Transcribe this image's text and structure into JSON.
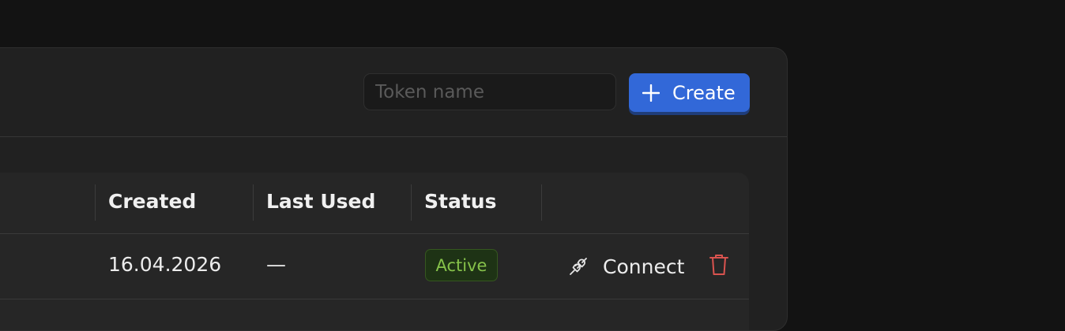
{
  "toolbar": {
    "token_input_placeholder": "Token name",
    "token_input_value": "",
    "create_label": "Create",
    "create_icon": "plus-icon"
  },
  "table": {
    "columns": [
      "Created",
      "Last Used",
      "Status"
    ],
    "rows": [
      {
        "created": "16.04.2026",
        "last_used": "—",
        "status": "Active",
        "connect_label": "Connect",
        "connect_icon": "plug-icon",
        "delete_icon": "trash-icon"
      }
    ]
  },
  "colors": {
    "accent": "#3268d8",
    "status_active": "#86c24a",
    "danger": "#d9534f"
  }
}
